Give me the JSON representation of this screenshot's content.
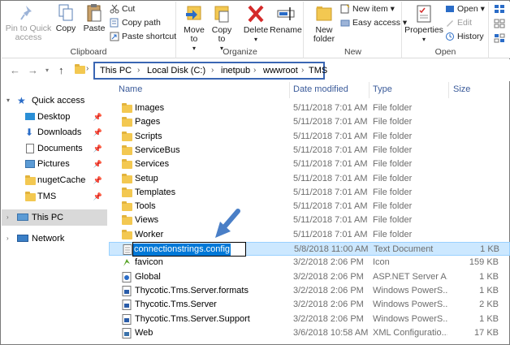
{
  "ribbon": {
    "clipboard": {
      "label": "Clipboard",
      "pin_label": "Pin to Quick access",
      "copy_label": "Copy",
      "paste_label": "Paste",
      "cut_label": "Cut",
      "copy_path_label": "Copy path",
      "paste_shortcut_label": "Paste shortcut"
    },
    "organize": {
      "label": "Organize",
      "move_to_label": "Move to",
      "copy_to_label": "Copy to",
      "delete_label": "Delete",
      "rename_label": "Rename"
    },
    "new": {
      "label": "New",
      "new_folder_label": "New folder",
      "new_item_label": "New item",
      "easy_access_label": "Easy access"
    },
    "open": {
      "label": "Open",
      "properties_label": "Properties",
      "open_label": "Open",
      "edit_label": "Edit",
      "history_label": "History"
    }
  },
  "address": {
    "crumbs": [
      "This PC",
      "Local Disk (C:)",
      "inetpub",
      "wwwroot",
      "TMS"
    ]
  },
  "nav": {
    "quick_access": "Quick access",
    "items": [
      {
        "label": "Desktop",
        "pinned": true
      },
      {
        "label": "Downloads",
        "pinned": true
      },
      {
        "label": "Documents",
        "pinned": true
      },
      {
        "label": "Pictures",
        "pinned": true
      },
      {
        "label": "nugetCache",
        "pinned": true
      },
      {
        "label": "TMS",
        "pinned": true
      }
    ],
    "this_pc": "This PC",
    "network": "Network"
  },
  "columns": {
    "name": "Name",
    "date": "Date modified",
    "type": "Type",
    "size": "Size"
  },
  "files": [
    {
      "name": "Images",
      "date": "5/11/2018 7:01 AM",
      "type": "File folder",
      "size": "",
      "icon": "folder"
    },
    {
      "name": "Pages",
      "date": "5/11/2018 7:01 AM",
      "type": "File folder",
      "size": "",
      "icon": "folder"
    },
    {
      "name": "Scripts",
      "date": "5/11/2018 7:01 AM",
      "type": "File folder",
      "size": "",
      "icon": "folder"
    },
    {
      "name": "ServiceBus",
      "date": "5/11/2018 7:01 AM",
      "type": "File folder",
      "size": "",
      "icon": "folder"
    },
    {
      "name": "Services",
      "date": "5/11/2018 7:01 AM",
      "type": "File folder",
      "size": "",
      "icon": "folder"
    },
    {
      "name": "Setup",
      "date": "5/11/2018 7:01 AM",
      "type": "File folder",
      "size": "",
      "icon": "folder"
    },
    {
      "name": "Templates",
      "date": "5/11/2018 7:01 AM",
      "type": "File folder",
      "size": "",
      "icon": "folder"
    },
    {
      "name": "Tools",
      "date": "5/11/2018 7:01 AM",
      "type": "File folder",
      "size": "",
      "icon": "folder"
    },
    {
      "name": "Views",
      "date": "5/11/2018 7:01 AM",
      "type": "File folder",
      "size": "",
      "icon": "folder"
    },
    {
      "name": "Worker",
      "date": "5/11/2018 7:01 AM",
      "type": "File folder",
      "size": "",
      "icon": "folder"
    },
    {
      "name": "connectionstrings.config",
      "date": "5/8/2018 11:00 AM",
      "type": "Text Document",
      "size": "1 KB",
      "icon": "text-file",
      "renaming": true
    },
    {
      "name": "favicon",
      "date": "3/2/2018 2:06 PM",
      "type": "Icon",
      "size": "159 KB",
      "icon": "favicon"
    },
    {
      "name": "Global",
      "date": "3/2/2018 2:06 PM",
      "type": "ASP.NET Server A...",
      "size": "1 KB",
      "icon": "aspx-file"
    },
    {
      "name": "Thycotic.Tms.Server.formats",
      "date": "3/2/2018 2:06 PM",
      "type": "Windows PowerS...",
      "size": "1 KB",
      "icon": "ps-file"
    },
    {
      "name": "Thycotic.Tms.Server",
      "date": "3/2/2018 2:06 PM",
      "type": "Windows PowerS...",
      "size": "2 KB",
      "icon": "ps-file"
    },
    {
      "name": "Thycotic.Tms.Server.Support",
      "date": "3/2/2018 2:06 PM",
      "type": "Windows PowerS...",
      "size": "1 KB",
      "icon": "ps-file"
    },
    {
      "name": "Web",
      "date": "3/6/2018 10:58 AM",
      "type": "XML Configuratio...",
      "size": "17 KB",
      "icon": "xml-file"
    }
  ],
  "colors": {
    "highlight": "#3a66b3",
    "selection": "#cce8ff",
    "folder": "#f3c851",
    "accent_arrow": "#4a7fc7"
  }
}
